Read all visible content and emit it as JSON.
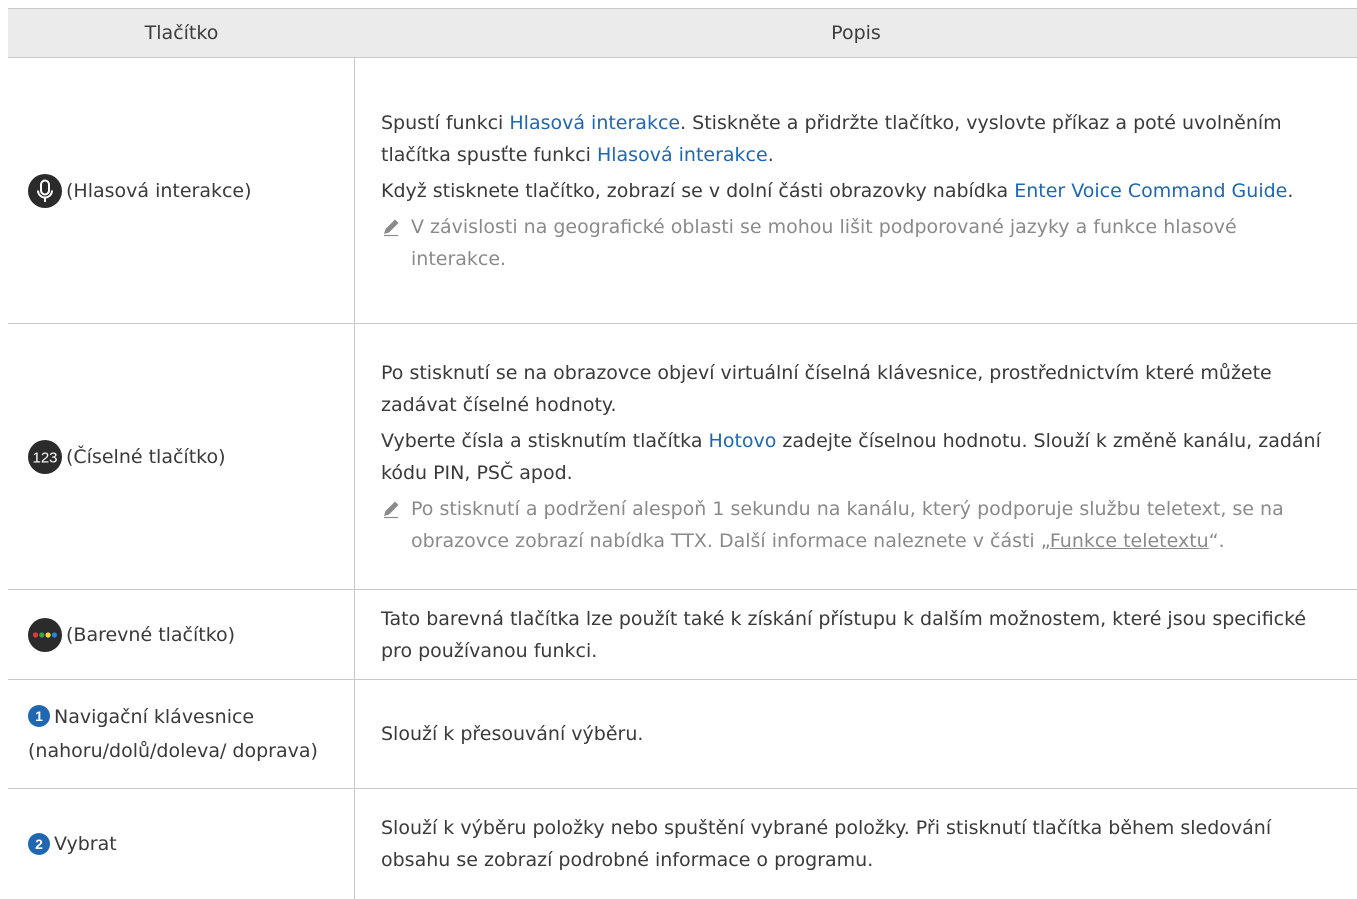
{
  "header": {
    "col1": "Tlačítko",
    "col2": "Popis"
  },
  "rows": [
    {
      "label": "(Hlasová interakce)",
      "icon": "microphone-icon",
      "para1_a": "Spustí funkci ",
      "para1_link1": "Hlasová interakce",
      "para1_b": ". Stiskněte a přidržte tlačítko, vyslovte příkaz a poté uvolněním tlačítka spusťte funkci ",
      "para1_link2": "Hlasová interakce",
      "para1_c": ".",
      "para2_a": "Když stisknete tlačítko, zobrazí se v dolní části obrazovky nabídka ",
      "para2_link": "Enter Voice Command Guide",
      "para2_b": ".",
      "note": "V závislosti na geografické oblasti se mohou lišit podporované jazyky a funkce hlasové interakce."
    },
    {
      "label": "(Číselné tlačítko)",
      "icon": "number-pad-icon",
      "icon_text": "123",
      "para1": "Po stisknutí se na obrazovce objeví virtuální číselná klávesnice, prostřednictvím které můžete zadávat číselné hodnoty.",
      "para2_a": "Vyberte čísla a stisknutím tlačítka ",
      "para2_link": "Hotovo",
      "para2_b": " zadejte číselnou hodnotu. Slouží k změně kanálu, zadání kódu PIN, PSČ apod.",
      "note_a": "Po stisknutí a podržení alespoň 1 sekundu na kanálu, který podporuje službu teletext, se na obrazovce zobrazí nabídka TTX. Další informace naleznete v části „",
      "note_link": "Funkce teletextu",
      "note_b": "“."
    },
    {
      "label": "(Barevné tlačítko)",
      "icon": "color-buttons-icon",
      "dot_colors": [
        "#e53935",
        "#43a047",
        "#fdd835",
        "#1e88e5"
      ],
      "para1": "Tato barevná tlačítka lze použít také k získání přístupu k dalším možnostem, které jsou specifické pro používanou funkci."
    },
    {
      "label": "Navigační klávesnice (nahoru/dolů/doleva/ doprava)",
      "icon": "number-1-badge-icon",
      "badge": "1",
      "para1": "Slouží k přesouvání výběru."
    },
    {
      "label": "Vybrat",
      "icon": "number-2-badge-icon",
      "badge": "2",
      "para1": "Slouží k výběru položky nebo spuštění vybrané položky. Při stisknutí tlačítka během sledování obsahu se zobrazí podrobné informace o programu."
    }
  ],
  "colors": {
    "link": "#1f67b1",
    "header_bg": "#ebebeb",
    "badge": "#1f67b1",
    "icon_dark": "#2b2b2b"
  }
}
